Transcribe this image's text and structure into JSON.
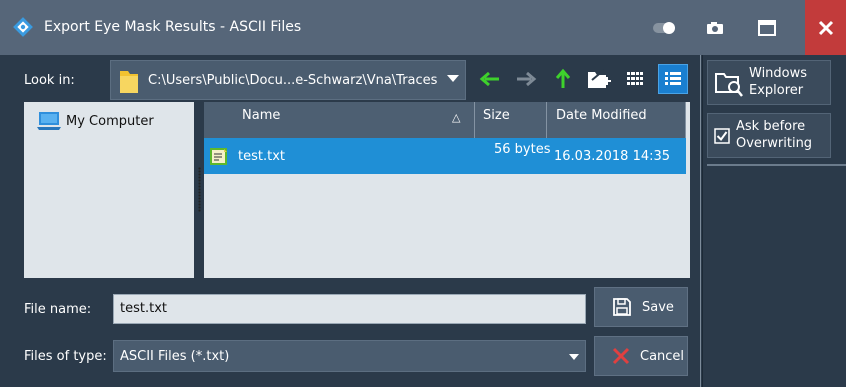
{
  "window": {
    "title": "Export Eye Mask Results - ASCII Files"
  },
  "toolbar": {
    "look_in_label": "Look in:",
    "path": "C:\\Users\\Public\\Docu...e-Schwarz\\Vna\\Traces",
    "icons": [
      "back-arrow-icon",
      "forward-arrow-icon",
      "up-folder-icon",
      "new-folder-icon",
      "list-view-icon",
      "detail-view-icon"
    ]
  },
  "sidebar": {
    "windows_explorer_label_1": "Windows",
    "windows_explorer_label_2": "Explorer",
    "ask_overwrite_label_1": "Ask before",
    "ask_overwrite_label_2": "Overwriting",
    "ask_overwrite_checked": true
  },
  "locations": {
    "items": [
      {
        "label": "My Computer"
      }
    ]
  },
  "file_list": {
    "columns": {
      "name": "Name",
      "size": "Size",
      "date": "Date Modified"
    },
    "sort_indicator": "△",
    "rows": [
      {
        "name": "test.txt",
        "size": "56 bytes",
        "date": "16.03.2018 14:35",
        "selected": true
      }
    ]
  },
  "form": {
    "file_name_label": "File name:",
    "file_name_value": "test.txt",
    "file_type_label": "Files of type:",
    "file_type_value": "ASCII Files (*.txt)"
  },
  "buttons": {
    "save": "Save",
    "cancel": "Cancel"
  },
  "colors": {
    "title_bar": "#566679",
    "background": "#2b3a4a",
    "selection": "#1f8fd6",
    "close": "#c23b3b",
    "arrow_green": "#3ed12c"
  }
}
